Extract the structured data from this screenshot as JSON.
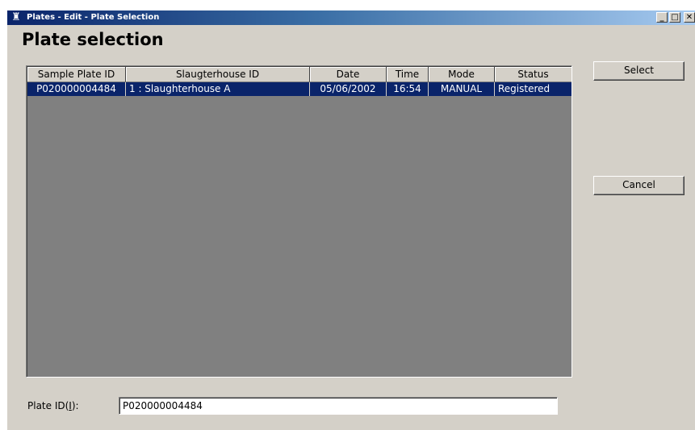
{
  "window": {
    "title": "Plates - Edit - Plate Selection",
    "minimize_glyph": "_",
    "maximize_glyph": "□",
    "close_glyph": "✕"
  },
  "page": {
    "heading": "Plate selection"
  },
  "table": {
    "columns": [
      "Sample Plate ID",
      "Slaugterhouse ID",
      "Date",
      "Time",
      "Mode",
      "Status"
    ],
    "rows": [
      [
        "P020000004484",
        "1 : Slaughterhouse A",
        "05/06/2002",
        "16:54",
        "MANUAL",
        "Registered"
      ]
    ],
    "selected_row": 0
  },
  "buttons": {
    "select_label": "Select",
    "cancel_label": "Cancel"
  },
  "plate_id": {
    "label_prefix": "Plate ID(",
    "label_accel": "I",
    "label_suffix": "):",
    "value": "P020000004484"
  },
  "colors": {
    "selection": "#0a246a",
    "grid_background": "#808080",
    "window_face": "#d4d0c8"
  },
  "icons": {
    "app": "app-icon"
  }
}
